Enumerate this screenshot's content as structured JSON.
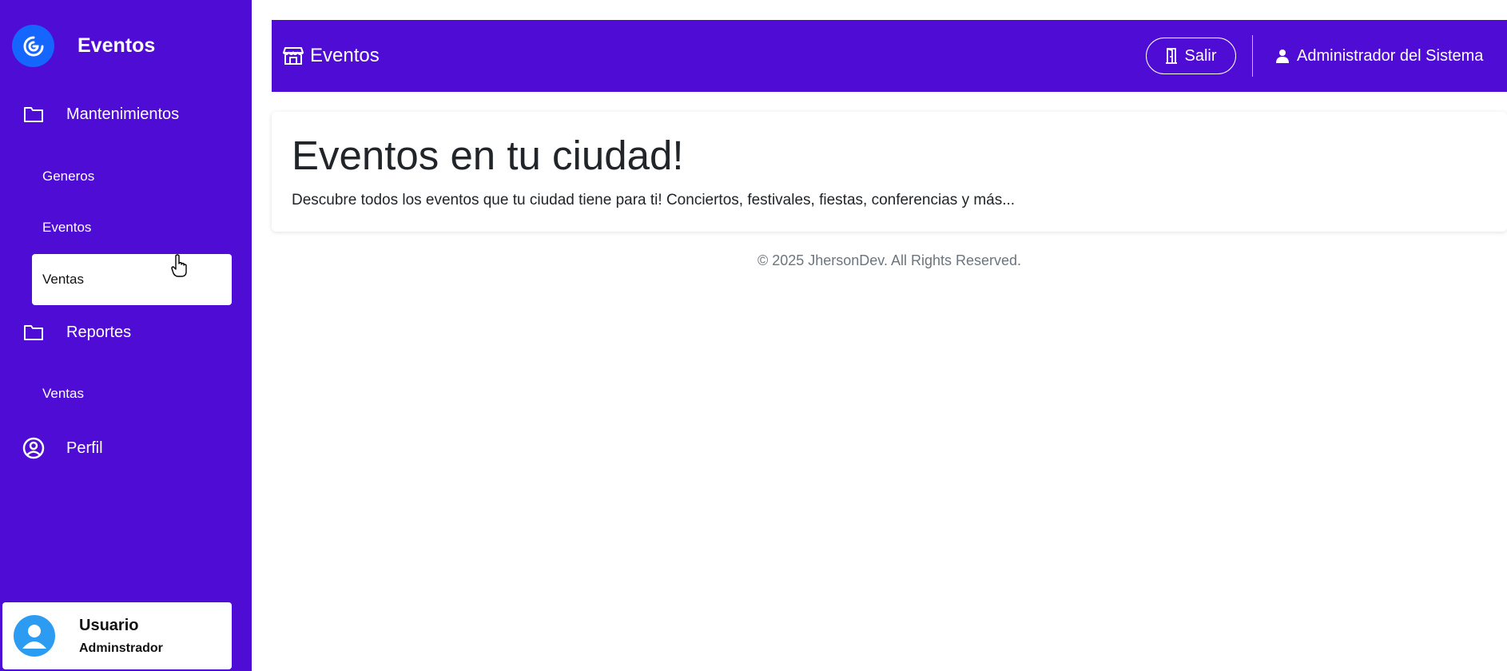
{
  "sidebar": {
    "brand": "Eventos",
    "sections": [
      {
        "label": "Mantenimientos",
        "icon": "folder-icon"
      },
      {
        "label": "Reportes",
        "icon": "folder-icon"
      },
      {
        "label": "Perfil",
        "icon": "user-circle-icon"
      }
    ],
    "maintenance_items": [
      {
        "label": "Generos"
      },
      {
        "label": "Eventos"
      },
      {
        "label": "Ventas",
        "active": true
      }
    ],
    "report_items": [
      {
        "label": "Ventas"
      }
    ],
    "user": {
      "name": "Usuario",
      "role": "Adminstrador"
    }
  },
  "topbar": {
    "title": "Eventos",
    "logout_label": "Salir",
    "user_label": "Administrador del Sistema"
  },
  "main": {
    "title": "Eventos en tu ciudad!",
    "description": "Descubre todos los eventos que tu ciudad tiene para ti! Conciertos, festivales, fiestas, conferencias y más..."
  },
  "footer": {
    "text": "© 2025 JhersonDev. All Rights Reserved."
  },
  "colors": {
    "primary": "#4f0cd4",
    "logo_blue": "#1565ff",
    "avatar_blue": "#2b9cf2"
  }
}
